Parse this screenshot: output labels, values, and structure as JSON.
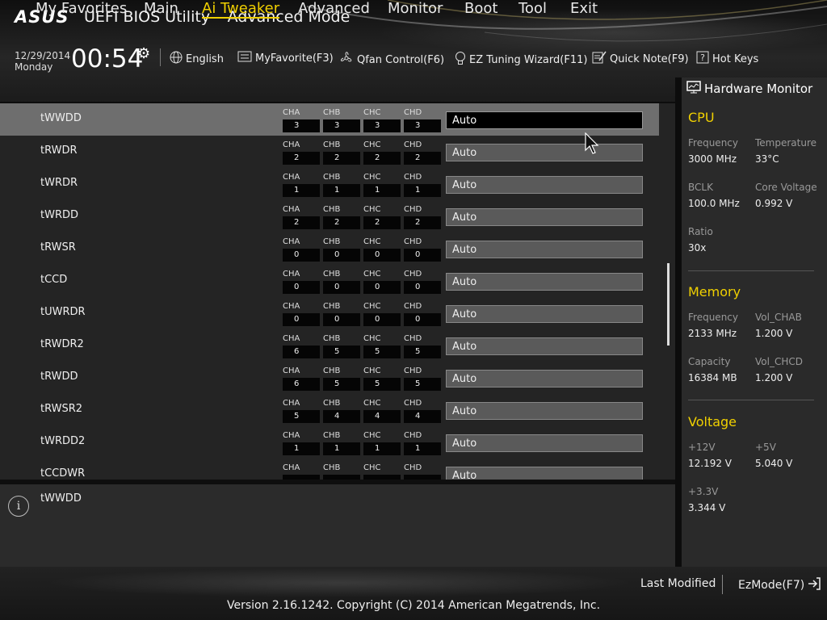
{
  "header": {
    "logo": "ASUS",
    "title": "UEFI BIOS Utility – Advanced Mode",
    "date": "12/29/2014",
    "day": "Monday",
    "time": "00:54",
    "tools": [
      {
        "label": "English",
        "icon": "globe-icon"
      },
      {
        "label": "MyFavorite(F3)",
        "icon": "favorite-icon"
      },
      {
        "label": "Qfan Control(F6)",
        "icon": "fan-icon"
      },
      {
        "label": "EZ Tuning Wizard(F11)",
        "icon": "bulb-icon"
      },
      {
        "label": "Quick Note(F9)",
        "icon": "note-icon"
      },
      {
        "label": "Hot Keys",
        "icon": "help-key-icon"
      }
    ]
  },
  "tabs": [
    {
      "label": "My Favorites"
    },
    {
      "label": "Main"
    },
    {
      "label": "Ai Tweaker",
      "active": true
    },
    {
      "label": "Advanced"
    },
    {
      "label": "Monitor"
    },
    {
      "label": "Boot"
    },
    {
      "label": "Tool"
    },
    {
      "label": "Exit"
    }
  ],
  "channel_names": [
    "CHA",
    "CHB",
    "CHC",
    "CHD"
  ],
  "rows": [
    {
      "label": "tWWDD",
      "channels": [
        "3",
        "3",
        "3",
        "3"
      ],
      "value": "Auto",
      "selected": true
    },
    {
      "label": "tRWDR",
      "channels": [
        "2",
        "2",
        "2",
        "2"
      ],
      "value": "Auto"
    },
    {
      "label": "tWRDR",
      "channels": [
        "1",
        "1",
        "1",
        "1"
      ],
      "value": "Auto"
    },
    {
      "label": "tWRDD",
      "channels": [
        "2",
        "2",
        "2",
        "2"
      ],
      "value": "Auto"
    },
    {
      "label": "tRWSR",
      "channels": [
        "0",
        "0",
        "0",
        "0"
      ],
      "value": "Auto"
    },
    {
      "label": "tCCD",
      "channels": [
        "0",
        "0",
        "0",
        "0"
      ],
      "value": "Auto"
    },
    {
      "label": "tUWRDR",
      "channels": [
        "0",
        "0",
        "0",
        "0"
      ],
      "value": "Auto"
    },
    {
      "label": "tRWDR2",
      "channels": [
        "6",
        "5",
        "5",
        "5"
      ],
      "value": "Auto"
    },
    {
      "label": "tRWDD",
      "channels": [
        "6",
        "5",
        "5",
        "5"
      ],
      "value": "Auto"
    },
    {
      "label": "tRWSR2",
      "channels": [
        "5",
        "4",
        "4",
        "4"
      ],
      "value": "Auto"
    },
    {
      "label": "tWRDD2",
      "channels": [
        "1",
        "1",
        "1",
        "1"
      ],
      "value": "Auto"
    },
    {
      "label": "tCCDWR",
      "channels": [
        "",
        "",
        "",
        ""
      ],
      "value": "Auto"
    }
  ],
  "help": {
    "text": "tWWDD"
  },
  "hw": {
    "title": "Hardware Monitor",
    "cpu": {
      "title": "CPU",
      "frequency_label": "Frequency",
      "frequency": "3000 MHz",
      "temperature_label": "Temperature",
      "temperature": "33°C",
      "bclk_label": "BCLK",
      "bclk": "100.0 MHz",
      "core_voltage_label": "Core Voltage",
      "core_voltage": "0.992 V",
      "ratio_label": "Ratio",
      "ratio": "30x"
    },
    "memory": {
      "title": "Memory",
      "frequency_label": "Frequency",
      "frequency": "2133 MHz",
      "vol_chab_label": "Vol_CHAB",
      "vol_chab": "1.200 V",
      "capacity_label": "Capacity",
      "capacity": "16384 MB",
      "vol_chcd_label": "Vol_CHCD",
      "vol_chcd": "1.200 V"
    },
    "voltage": {
      "title": "Voltage",
      "v12_label": "+12V",
      "v12": "12.192 V",
      "v5_label": "+5V",
      "v5": "5.040 V",
      "v33_label": "+3.3V",
      "v33": "3.344 V"
    }
  },
  "footer": {
    "last_modified": "Last Modified",
    "ezmode": "EzMode(F7)",
    "version": "Version 2.16.1242. Copyright (C) 2014 American Megatrends, Inc."
  },
  "colors": {
    "accent": "#f0d000",
    "selected_row": "#6e6e6e"
  }
}
